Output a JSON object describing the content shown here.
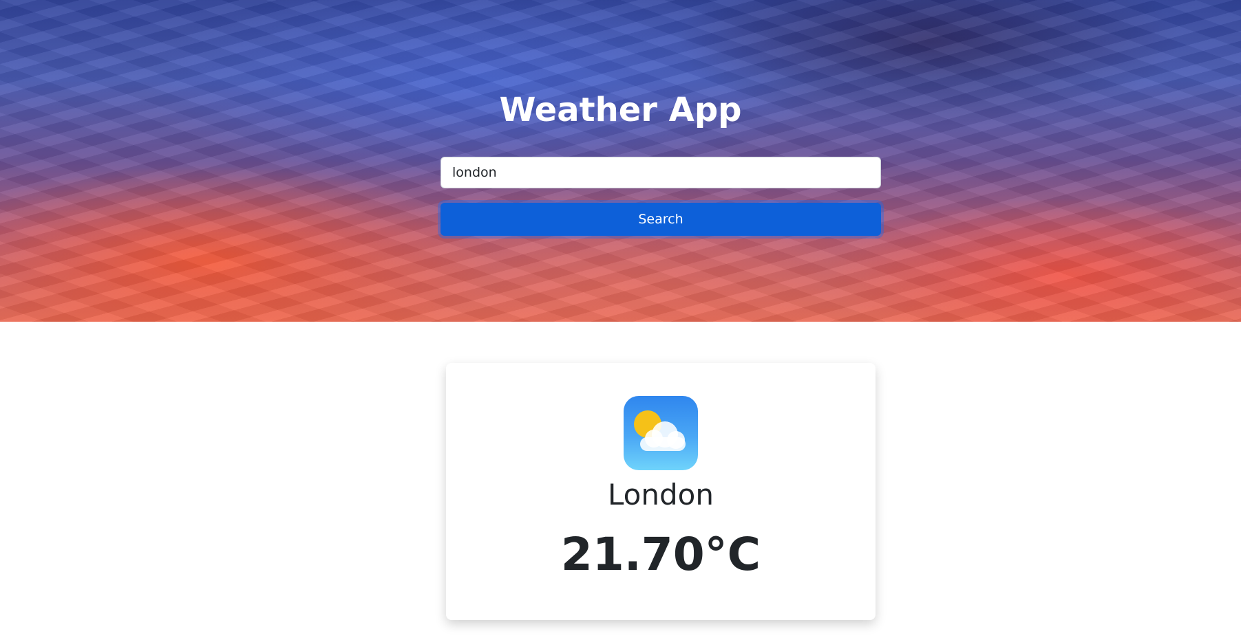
{
  "app": {
    "title": "Weather App"
  },
  "search": {
    "value": "london",
    "button_label": "Search"
  },
  "weather": {
    "city": "London",
    "temperature": "21.70°C",
    "icon": "partly-cloudy-icon"
  },
  "colors": {
    "button": "#0d60d9",
    "text_dark": "#212529"
  }
}
